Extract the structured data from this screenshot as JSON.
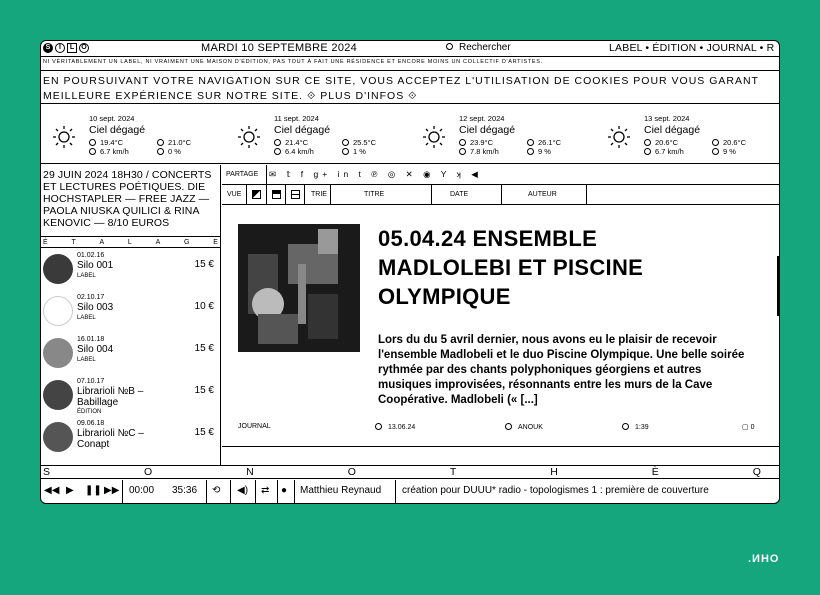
{
  "topbar": {
    "logo_letters": [
      "S",
      "I",
      "L",
      "O"
    ],
    "date": "MARDI 10 SEPTEMBRE 2024",
    "search_label": "Rechercher",
    "nav": "LABEL • ÉDITION • JOURNAL • R",
    "tagline": "NI VÉRITABLEMENT UN LABEL, NI VRAIMENT UNE MAISON D'ÉDITION, PAS TOUT À FAIT UNE RÉSIDENCE ET ENCORE MOINS UN COLLECTIF D'ARTISTES."
  },
  "cookie": {
    "line1": "EN POURSUIVANT VOTRE NAVIGATION SUR CE SITE, VOUS ACCEPTEZ L'UTILISATION DE COOKIES POUR VOUS GARANT",
    "line2": "MEILLEURE EXPÉRIENCE SUR NOTRE SITE.",
    "more": "PLUS D'INFOS"
  },
  "weather": [
    {
      "date": "10 sept. 2024",
      "condition": "Ciel dégagé",
      "min": "19.4°C",
      "max": "21.0°C",
      "wind": "6.7 km/h",
      "rain": "0 %"
    },
    {
      "date": "11 sept. 2024",
      "condition": "Ciel dégagé",
      "min": "21.4°C",
      "max": "25.5°C",
      "wind": "6.4 km/h",
      "rain": "1 %"
    },
    {
      "date": "12 sept. 2024",
      "condition": "Ciel dégagé",
      "min": "23.9°C",
      "max": "26.1°C",
      "wind": "7.8 km/h",
      "rain": "9 %"
    },
    {
      "date": "13 sept. 2024",
      "condition": "Ciel dégagé",
      "min": "20.6°C",
      "max": "20.6°C",
      "wind": "6.7 km/h",
      "rain": "9 %"
    }
  ],
  "event": {
    "text": "29 JUIN 2024 18H30 / CONCERTS ET LECTURES POÉTIQUES. DIE HOCHSTAPLER — FREE JAZZ — PAOLA NIUSKA QUILICI & RINA KENOVIC — 8/10 EUROS"
  },
  "etalage": {
    "letters": [
      "É",
      "T",
      "A",
      "L",
      "A",
      "G",
      "E"
    ]
  },
  "products": [
    {
      "date": "01.02.16",
      "title": "Silo 001",
      "kind": "LABEL",
      "price": "15 €"
    },
    {
      "date": "02.10.17",
      "title": "Silo 003",
      "kind": "LABEL",
      "price": "10 €"
    },
    {
      "date": "16.01.18",
      "title": "Silo 004",
      "kind": "LABEL",
      "price": "15 €"
    },
    {
      "date": "07.10.17",
      "title": "Librarioli №B – Babillage",
      "kind": "ÉDITION",
      "price": "15 €"
    },
    {
      "date": "09.06.18",
      "title": "Librarioli №C – Conapt",
      "kind": "",
      "price": "15 €"
    }
  ],
  "share": {
    "label": "PARTAGE",
    "icons": "✉ 𝕥 f g+ in t ℗ ◎ ✕ ◉ Y ʞ ◀"
  },
  "sortbar": {
    "view": "VUE",
    "sort": "TRIE",
    "title": "TITRE",
    "date": "DATE",
    "author": "AUTEUR"
  },
  "article": {
    "title": "05.04.24 ENSEMBLE MADLOLEBI ET PISCINE OLYMPIQUE",
    "body": "Lors du du 5 avril dernier, nous avons eu le plaisir de recevoir l'ensemble Madlobeli et le duo Piscine Olympique. Une belle soirée rythmée par des chants polyphoniques géorgiens et autres musiques improvisées, résonnants entre les murs de la Cave Coopérative. Madlobeli (« [...]",
    "category": "JOURNAL",
    "date": "13.06.24",
    "author": "ANOUK",
    "read_time": "1:39",
    "comments": "0"
  },
  "sonoteque": {
    "letters": [
      "S",
      "O",
      "N",
      "O",
      "T",
      "H",
      "È",
      "Q"
    ]
  },
  "player": {
    "elapsed": "00:00",
    "duration": "35:36",
    "artist": "Matthieu Reynaud",
    "track": "création pour DUUU* radio - topologismes 1 : première de couverture"
  },
  "watermark": ".ИНО"
}
